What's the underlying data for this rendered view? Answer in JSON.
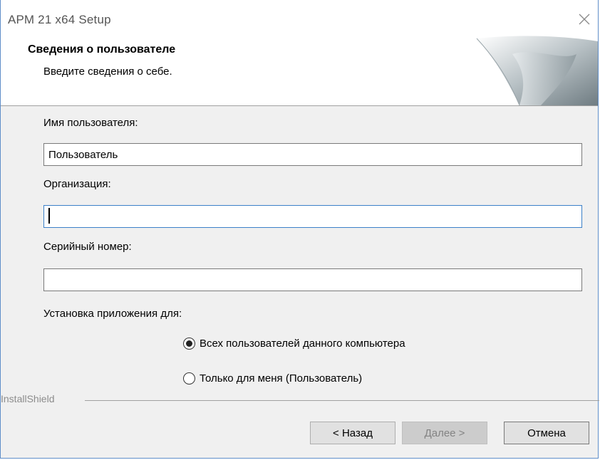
{
  "window": {
    "title": "АРМ 21 x64  Setup"
  },
  "header": {
    "title": "Сведения о пользователе",
    "subtitle": "Введите сведения о себе."
  },
  "form": {
    "username_label": "Имя пользователя:",
    "username_value": "Пользователь",
    "organization_label": "Организация:",
    "organization_value": "",
    "serial_label": "Серийный номер:",
    "serial_value": "",
    "install_for_label": "Установка приложения для:",
    "options": [
      {
        "label": "Всех пользователей данного компьютера",
        "selected": true
      },
      {
        "label": "Только для меня (Пользователь)",
        "selected": false
      }
    ]
  },
  "footer": {
    "brand": "InstallShield",
    "back_label": "< Назад",
    "next_label": "Далее >",
    "cancel_label": "Отмена"
  },
  "colors": {
    "accent": "#3c80c8",
    "border": "#5f8ec9"
  }
}
